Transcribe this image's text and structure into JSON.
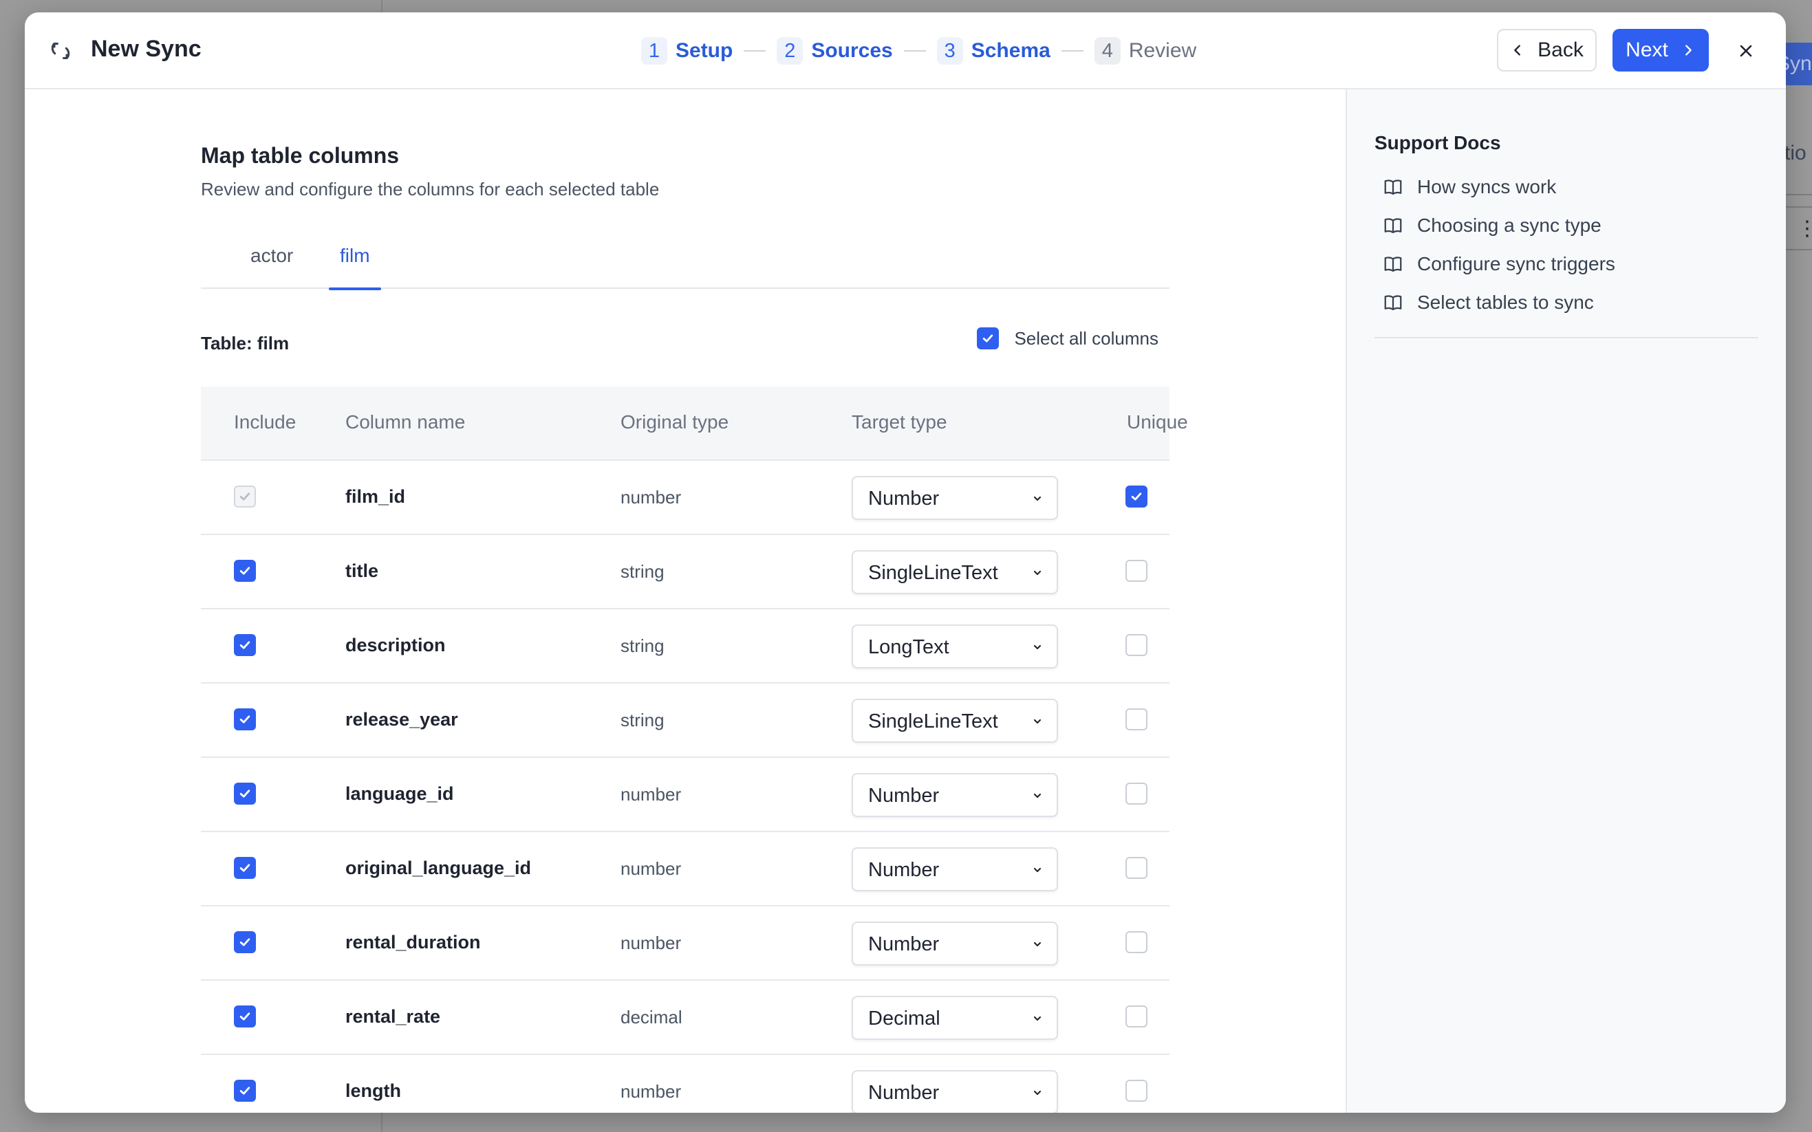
{
  "background": {
    "right_button_label": "Syn",
    "right_text": "tio"
  },
  "header": {
    "title": "New Sync",
    "steps": [
      {
        "num": "1",
        "label": "Setup"
      },
      {
        "num": "2",
        "label": "Sources"
      },
      {
        "num": "3",
        "label": "Schema"
      },
      {
        "num": "4",
        "label": "Review"
      }
    ],
    "back_label": "Back",
    "next_label": "Next"
  },
  "main": {
    "title": "Map table columns",
    "subtitle": "Review and configure the columns for each selected table",
    "tabs": [
      {
        "label": "actor",
        "active": false
      },
      {
        "label": "film",
        "active": true
      }
    ],
    "table_label": "Table: film",
    "select_all_label": "Select all columns",
    "select_all_checked": true,
    "headers": {
      "include": "Include",
      "column_name": "Column name",
      "original_type": "Original type",
      "target_type": "Target type",
      "unique": "Unique"
    },
    "rows": [
      {
        "name": "film_id",
        "original": "number",
        "target": "Number",
        "include": "disabled",
        "unique": true
      },
      {
        "name": "title",
        "original": "string",
        "target": "SingleLineText",
        "include": "on",
        "unique": false
      },
      {
        "name": "description",
        "original": "string",
        "target": "LongText",
        "include": "on",
        "unique": false
      },
      {
        "name": "release_year",
        "original": "string",
        "target": "SingleLineText",
        "include": "on",
        "unique": false
      },
      {
        "name": "language_id",
        "original": "number",
        "target": "Number",
        "include": "on",
        "unique": false
      },
      {
        "name": "original_language_id",
        "original": "number",
        "target": "Number",
        "include": "on",
        "unique": false
      },
      {
        "name": "rental_duration",
        "original": "number",
        "target": "Number",
        "include": "on",
        "unique": false
      },
      {
        "name": "rental_rate",
        "original": "decimal",
        "target": "Decimal",
        "include": "on",
        "unique": false
      },
      {
        "name": "length",
        "original": "number",
        "target": "Number",
        "include": "on",
        "unique": false
      }
    ]
  },
  "side": {
    "title": "Support Docs",
    "docs": [
      "How syncs work",
      "Choosing a sync type",
      "Configure sync triggers",
      "Select tables to sync"
    ]
  },
  "colors": {
    "accent": "#2f5ff0",
    "accent_text": "#2a5bd7"
  }
}
